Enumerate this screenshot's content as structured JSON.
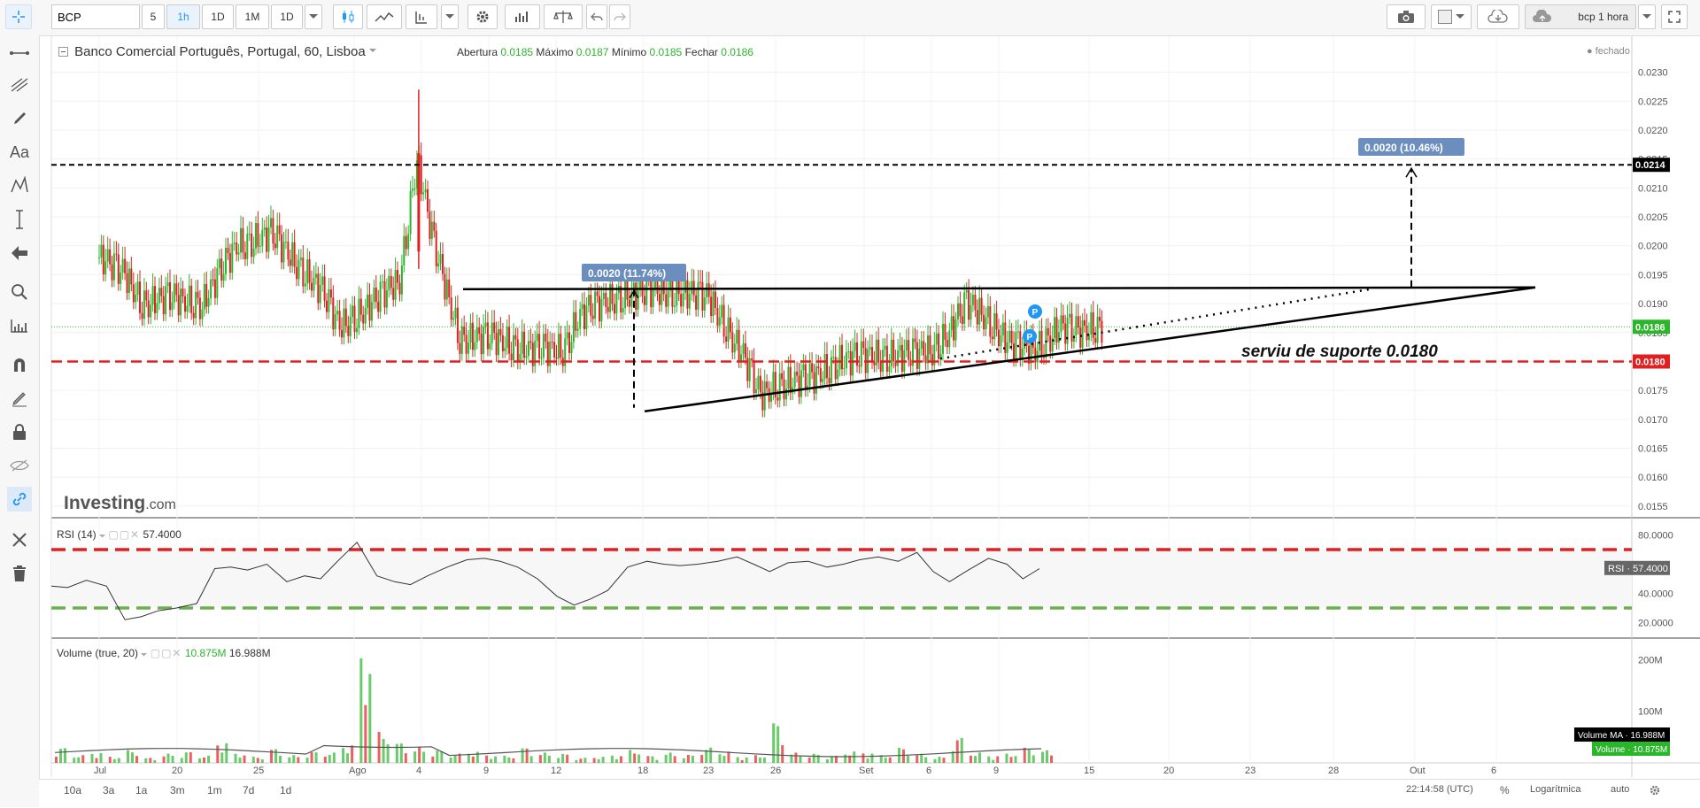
{
  "toolbar": {
    "symbol": "BCP",
    "intervals": [
      "5",
      "1h",
      "1D",
      "1M",
      "1D"
    ],
    "active_interval": "1h",
    "layout_name": "bcp 1 hora"
  },
  "legend": {
    "title": "Banco Comercial Português, Portugal, 60, Lisboa",
    "open_label": "Abertura",
    "open": "0.0185",
    "high_label": "Máximo",
    "high": "0.0187",
    "low_label": "Mínimo",
    "low": "0.0185",
    "close_label": "Fechar",
    "close": "0.0186",
    "status": "fechado"
  },
  "price_axis": {
    "ticks": [
      "0.0230",
      "0.0225",
      "0.0220",
      "0.0215",
      "0.0210",
      "0.0205",
      "0.0200",
      "0.0195",
      "0.0190",
      "0.0185",
      "0.0180",
      "0.0175",
      "0.0170",
      "0.0165",
      "0.0160",
      "0.0155"
    ],
    "labels": [
      {
        "text": "0.0214",
        "color": "#000000"
      },
      {
        "text": "0.0186",
        "color": "#2bb52b"
      },
      {
        "text": "0.0180",
        "color": "#e02020"
      }
    ]
  },
  "rsi": {
    "title": "RSI (14)",
    "value": "57.4000",
    "ticks": [
      "80.0000",
      "40.0000",
      "20.0000"
    ],
    "label_name": "RSI",
    "label_value": "57.4000"
  },
  "volume": {
    "title": "Volume (true, 20)",
    "v1": "10.875M",
    "v2": "16.988M",
    "ticks": [
      "200M",
      "100M"
    ],
    "ma_label": "Volume MA",
    "ma_value": "16.988M",
    "vol_label": "Volume",
    "vol_value": "10.875M"
  },
  "time_axis": {
    "labels": [
      "Jul",
      "20",
      "25",
      "Ago",
      "4",
      "9",
      "12",
      "18",
      "23",
      "26",
      "Set",
      "6",
      "9",
      "15",
      "20",
      "23",
      "28",
      "Out",
      "6"
    ]
  },
  "annotations": {
    "measure1": "0.0020 (11.74%)",
    "measure2": "0.0020 (10.46%)",
    "support_text": "serviu de suporte 0.0180",
    "marker": "P"
  },
  "bottom": {
    "ranges": [
      "10a",
      "3a",
      "1a",
      "3m",
      "1m",
      "7d",
      "1d"
    ],
    "time": "22:14:58 (UTC)",
    "percent": "%",
    "log": "Logarítmica",
    "auto": "auto"
  },
  "branding": {
    "logo_bold": "Investing",
    "logo_light": ".com"
  },
  "colors": {
    "up": "#2bb52b",
    "down": "#e02020",
    "accent": "#2196f3",
    "measure": "#6c8ebf"
  },
  "chart_data": [
    {
      "type": "candlestick",
      "title": "",
      "x_labels": [
        "Jul",
        "20",
        "25",
        "Ago",
        "4",
        "9",
        "12",
        "18",
        "23",
        "26",
        "Set",
        "6",
        "9",
        "15",
        "20",
        "23",
        "28",
        "Out",
        "6"
      ],
      "ylim": [
        0.0153,
        0.0233
      ],
      "resistance": 0.01925,
      "support": 0.018,
      "target": 0.0214,
      "last_price": 0.0186,
      "spike_high": 0.0227,
      "low_point": 0.0172,
      "close_path": [
        [
          0,
          0.0198
        ],
        [
          3,
          0.0195
        ],
        [
          5,
          0.019
        ],
        [
          8,
          0.0191
        ],
        [
          12,
          0.019
        ],
        [
          16,
          0.02
        ],
        [
          20,
          0.0202
        ],
        [
          23,
          0.0197
        ],
        [
          26,
          0.0192
        ],
        [
          28,
          0.0186
        ],
        [
          31,
          0.0189
        ],
        [
          35,
          0.0194
        ],
        [
          37,
          0.0215
        ],
        [
          39,
          0.02
        ],
        [
          42,
          0.0184
        ],
        [
          46,
          0.0184
        ],
        [
          50,
          0.0182
        ],
        [
          54,
          0.0182
        ],
        [
          56,
          0.0188
        ],
        [
          60,
          0.0191
        ],
        [
          64,
          0.0192
        ],
        [
          67,
          0.0192
        ],
        [
          71,
          0.0191
        ],
        [
          73,
          0.0186
        ],
        [
          75,
          0.0181
        ],
        [
          77,
          0.0174
        ],
        [
          79,
          0.0176
        ],
        [
          83,
          0.0177
        ],
        [
          86,
          0.018
        ],
        [
          90,
          0.0181
        ],
        [
          94,
          0.0181
        ],
        [
          97,
          0.0182
        ],
        [
          99,
          0.0185
        ],
        [
          101,
          0.019
        ],
        [
          103,
          0.0188
        ],
        [
          106,
          0.0183
        ],
        [
          109,
          0.0182
        ],
        [
          112,
          0.0186
        ],
        [
          114,
          0.0185
        ],
        [
          116,
          0.0186
        ]
      ]
    },
    {
      "type": "line",
      "title": "RSI (14)",
      "ylim": [
        10,
        90
      ],
      "levels": [
        70,
        30
      ],
      "values": [
        45,
        44,
        49,
        45,
        22,
        24,
        28,
        30,
        33,
        57,
        58,
        56,
        60,
        48,
        52,
        50,
        62,
        75,
        52,
        48,
        46,
        52,
        58,
        63,
        64,
        62,
        58,
        50,
        38,
        32,
        36,
        42,
        58,
        62,
        60,
        59,
        60,
        62,
        65,
        60,
        55,
        61,
        62,
        58,
        60,
        63,
        65,
        62,
        68,
        55,
        48,
        56,
        64,
        60,
        50,
        57
      ]
    },
    {
      "type": "bar",
      "title": "Volume (true, 20)",
      "ylim": [
        0,
        240
      ],
      "values": [
        30,
        15,
        20,
        12,
        25,
        10,
        18,
        22,
        14,
        40,
        18,
        12,
        28,
        15,
        22,
        20,
        35,
        210,
        60,
        40,
        30,
        25,
        18,
        22,
        15,
        14,
        30,
        20,
        18,
        10,
        12,
        15,
        25,
        14,
        20,
        16,
        30,
        22,
        12,
        15,
        80,
        20,
        18,
        14,
        22,
        20,
        15,
        30,
        18,
        12,
        50,
        20,
        14,
        18,
        30,
        25
      ]
    }
  ]
}
